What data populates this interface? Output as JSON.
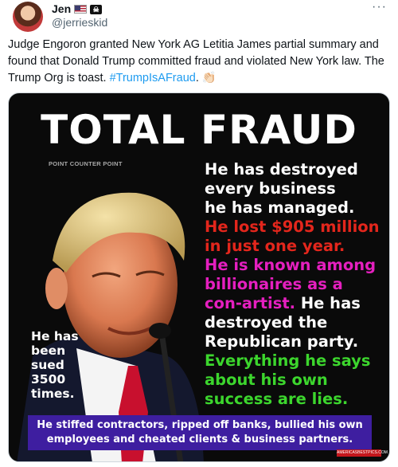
{
  "post": {
    "author_name": "Jen",
    "handle": "@jerrieskid",
    "more_label": "···",
    "text_before": "Judge Engoron granted New York AG Letitia James partial summary and found that Donald Trump committed fraud and violated New York law. The Trump Org is toast. ",
    "hashtag": "#TrumpIsAFraud",
    "text_after": ". 👏🏻"
  },
  "image": {
    "title": "TOTAL FRAUD",
    "source_label": "POINT COUNTER POINT",
    "right_lines": [
      {
        "text": "He has destroyed",
        "color": "white"
      },
      {
        "text": "every business",
        "color": "white"
      },
      {
        "text": "he has managed.",
        "color": "white"
      },
      {
        "text": "He lost $905 million",
        "color": "red"
      },
      {
        "text": "in just one year.",
        "color": "red"
      },
      {
        "text": "He is known among",
        "color": "magenta"
      },
      {
        "text": "billionaires as a",
        "color": "magenta"
      },
      {
        "text": "con-artist.",
        "color": "magenta"
      },
      {
        "text": " He has",
        "color": "white"
      },
      {
        "text": "destroyed the",
        "color": "white"
      },
      {
        "text": "Republican party.",
        "color": "white"
      },
      {
        "text": "Everything he says",
        "color": "green"
      },
      {
        "text": "about his own",
        "color": "green"
      },
      {
        "text": "success are lies.",
        "color": "green"
      }
    ],
    "left_lines": [
      "He has",
      "been",
      "sued",
      "3500",
      "times."
    ],
    "footer_line1": "He stiffed contractors, ripped off banks, bullied his own",
    "footer_line2": "employees and cheated clients & business partners.",
    "watermark": "AMERICASBESTPICS.COM"
  },
  "colors": {
    "accent": "#1d9bf0",
    "red_text": "#e3261c",
    "magenta_text": "#e51fbf",
    "green_text": "#3cd62d",
    "footer_bar": "#3e1ea0"
  }
}
